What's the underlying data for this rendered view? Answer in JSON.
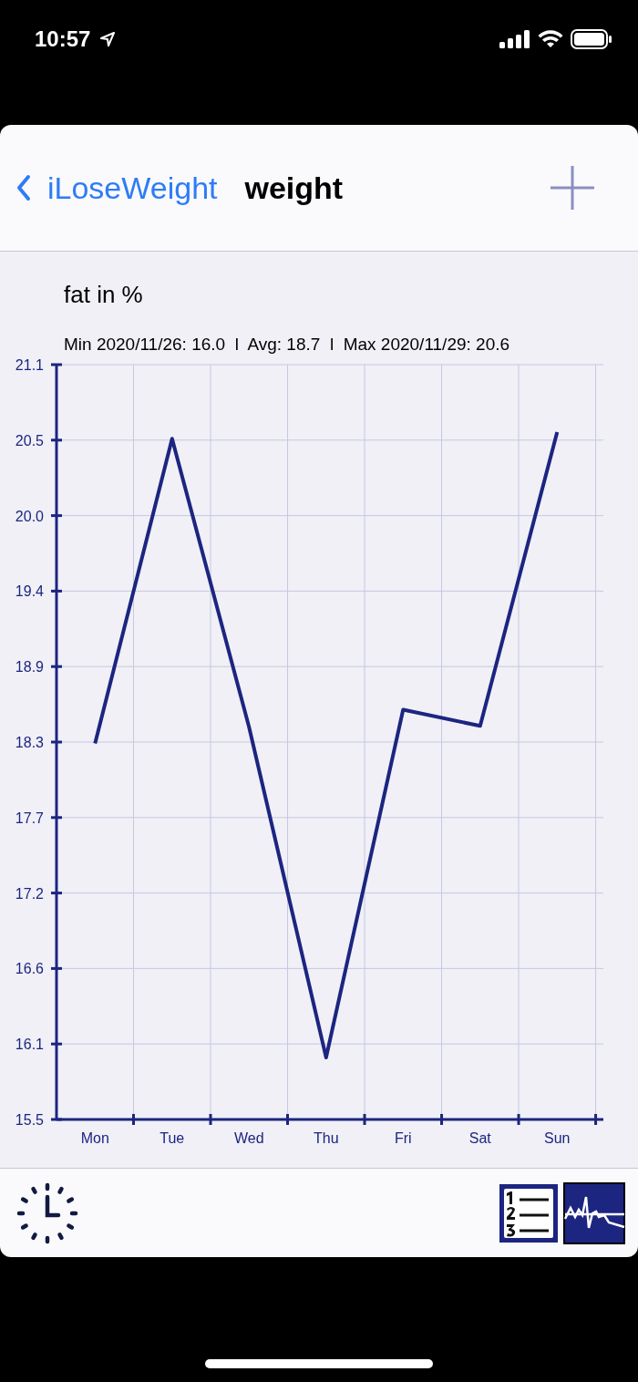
{
  "status_bar": {
    "time": "10:57"
  },
  "nav": {
    "back_label": "iLoseWeight",
    "title": "weight"
  },
  "chart_title": "fat in %",
  "stats": "Min 2020/11/26: 16.0  l  Avg: 18.7  l  Max 2020/11/29: 20.6",
  "chart_data": {
    "type": "line",
    "grid": true,
    "ylim": [
      15.5,
      21.1
    ],
    "categories": [
      "Mon",
      "Tue",
      "Wed",
      "Thu",
      "Fri",
      "Sat",
      "Sun"
    ],
    "yticks": [
      {
        "value": 15.5,
        "label": "15.5"
      },
      {
        "value": 16.06,
        "label": "16.1"
      },
      {
        "value": 16.62,
        "label": "16.6"
      },
      {
        "value": 17.18,
        "label": "17.2"
      },
      {
        "value": 17.74,
        "label": "17.7"
      },
      {
        "value": 18.3,
        "label": "18.3"
      },
      {
        "value": 18.86,
        "label": "18.9"
      },
      {
        "value": 19.42,
        "label": "19.4"
      },
      {
        "value": 19.98,
        "label": "20.0"
      },
      {
        "value": 20.54,
        "label": "20.5"
      },
      {
        "value": 21.1,
        "label": "21.1"
      }
    ],
    "series": [
      {
        "color": "#1c2580",
        "values": [
          18.29,
          20.55,
          18.41,
          15.96,
          18.54,
          18.42,
          20.6
        ]
      }
    ]
  }
}
